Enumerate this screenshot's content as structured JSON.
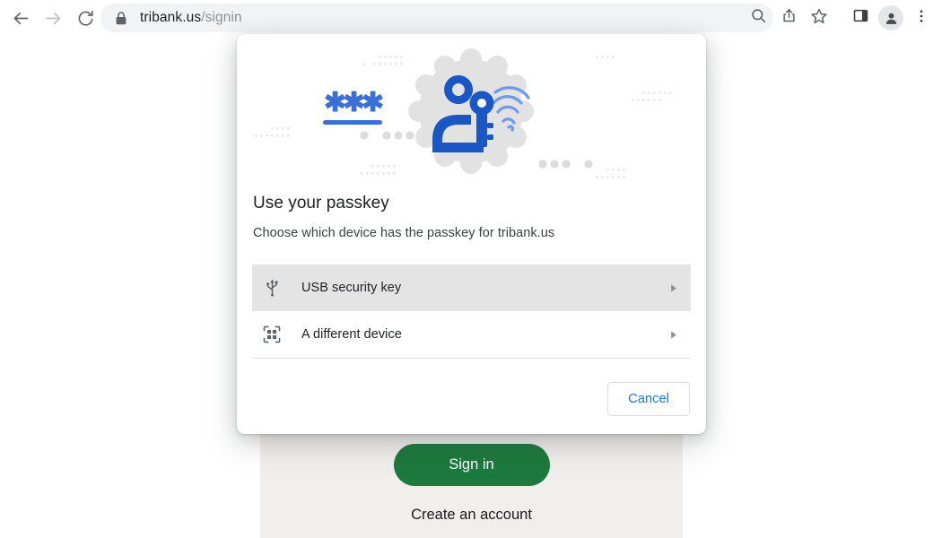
{
  "browser": {
    "nav": {
      "back_icon": "arrow-left-icon",
      "forward_icon": "arrow-right-icon",
      "reload_icon": "reload-icon"
    },
    "omnibox": {
      "lock_icon": "lock-icon",
      "url_host": "tribank.us",
      "url_path": "/signin",
      "full_url": "tribank.us/signin"
    },
    "actions": [
      {
        "name": "search-icon",
        "label": "Search"
      },
      {
        "name": "share-icon",
        "label": "Share"
      },
      {
        "name": "bookmark-star-icon",
        "label": "Bookmark"
      },
      {
        "name": "side-panel-icon",
        "label": "Side panel"
      },
      {
        "name": "profile-avatar-icon",
        "label": "Profile"
      },
      {
        "name": "more-menu-icon",
        "label": "Customize and control Google Chrome"
      }
    ]
  },
  "page": {
    "signin_button_label": "Sign in",
    "create_account_label": "Create an account"
  },
  "dialog": {
    "illustration_name": "passkey-illustration",
    "title": "Use your passkey",
    "subtitle": "Choose which device has the passkey for tribank.us",
    "options": [
      {
        "label": "USB security key",
        "icon": "usb-icon",
        "selected": true
      },
      {
        "label": "A different device",
        "icon": "qr-scan-icon",
        "selected": false
      }
    ],
    "cancel_label": "Cancel"
  },
  "colors": {
    "accent_blue": "#1a73e8",
    "signin_green": "#1d7a3e",
    "page_panel": "#f1efec",
    "omnibox_bg": "#f1f3f4",
    "selected_row": "#e4e4e4",
    "illustration_badge": "#e0e0e0",
    "illustration_blue": "#1a56c4",
    "illustration_light_blue": "#6f9ae8"
  }
}
